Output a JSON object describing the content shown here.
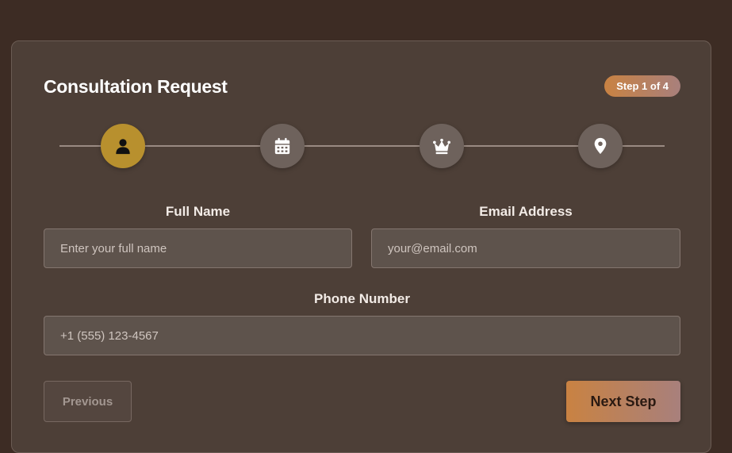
{
  "form": {
    "title": "Consultation Request",
    "step_badge": "Step 1 of 4",
    "steps": [
      {
        "icon": "user-icon",
        "active": true
      },
      {
        "icon": "calendar-icon",
        "active": false
      },
      {
        "icon": "crown-icon",
        "active": false
      },
      {
        "icon": "location-pin-icon",
        "active": false
      }
    ],
    "fields": {
      "full_name": {
        "label": "Full Name",
        "placeholder": "Enter your full name",
        "value": ""
      },
      "email": {
        "label": "Email Address",
        "placeholder": "your@email.com",
        "value": ""
      },
      "phone": {
        "label": "Phone Number",
        "placeholder": "+1 (555) 123-4567",
        "value": ""
      }
    },
    "buttons": {
      "previous": "Previous",
      "next": "Next Step"
    }
  },
  "colors": {
    "page_bg": "#3d2c24",
    "card_bg": "#4d3f37",
    "active_step": "#b8902e",
    "inactive_step": "#6e625c",
    "accent_gradient_start": "#c98242",
    "accent_gradient_end": "#a8807c"
  }
}
